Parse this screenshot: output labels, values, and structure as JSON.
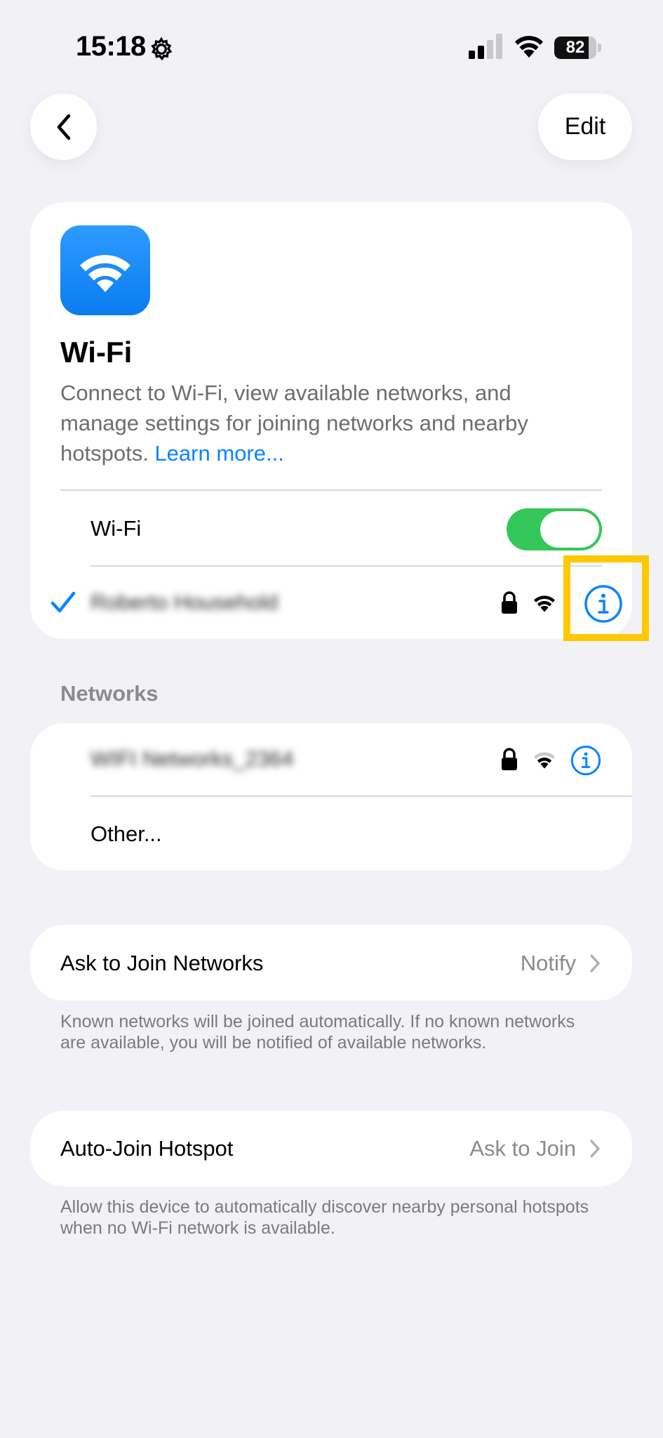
{
  "status_bar": {
    "time": "15:18",
    "battery_percent": "82",
    "battery_level": 0.82
  },
  "nav": {
    "edit_label": "Edit"
  },
  "wifi": {
    "title": "Wi-Fi",
    "description": "Connect to Wi-Fi, view available networks, and manage settings for joining networks and nearby hotspots.",
    "learn_more": "Learn more...",
    "toggle_label": "Wi-Fi",
    "toggle_on": true,
    "connected_network": "Roberto Household"
  },
  "networks": {
    "header": "Networks",
    "items": [
      {
        "name": "WIFI Networks_2364"
      }
    ],
    "other_label": "Other..."
  },
  "ask_to_join": {
    "label": "Ask to Join Networks",
    "value": "Notify",
    "footnote": "Known networks will be joined automatically. If no known networks are available, you will be notified of available networks."
  },
  "auto_join": {
    "label": "Auto-Join Hotspot",
    "value": "Ask to Join",
    "footnote": "Allow this device to automatically discover nearby personal hotspots when no Wi-Fi network is available."
  },
  "colors": {
    "accent": "#0a84ff",
    "toggle_on": "#34c759",
    "highlight": "#ffc800"
  }
}
